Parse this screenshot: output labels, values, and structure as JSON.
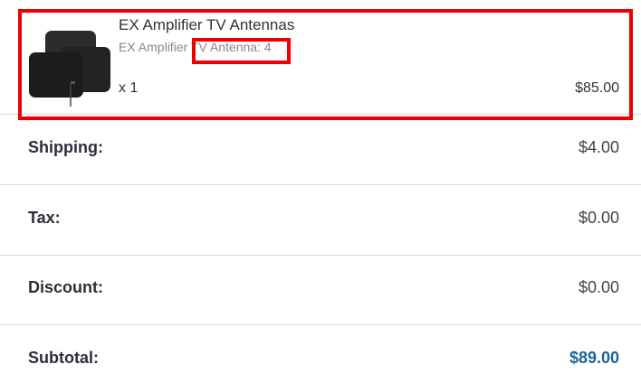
{
  "item": {
    "name": "EX Amplifier TV Antennas",
    "variant": "EX Amplifier TV Antenna: 4",
    "quantity": "x 1",
    "price": "$85.00",
    "image_icon": "tv-antenna-product-image"
  },
  "summary": {
    "shipping": {
      "label": "Shipping:",
      "value": "$4.00"
    },
    "tax": {
      "label": "Tax:",
      "value": "$0.00"
    },
    "discount": {
      "label": "Discount:",
      "value": "$0.00"
    },
    "subtotal": {
      "label": "Subtotal:",
      "value": "$89.00"
    }
  },
  "colors": {
    "highlight": "#ee0000",
    "subtotal_value": "#1a6496",
    "divider": "#d9d9d9"
  }
}
